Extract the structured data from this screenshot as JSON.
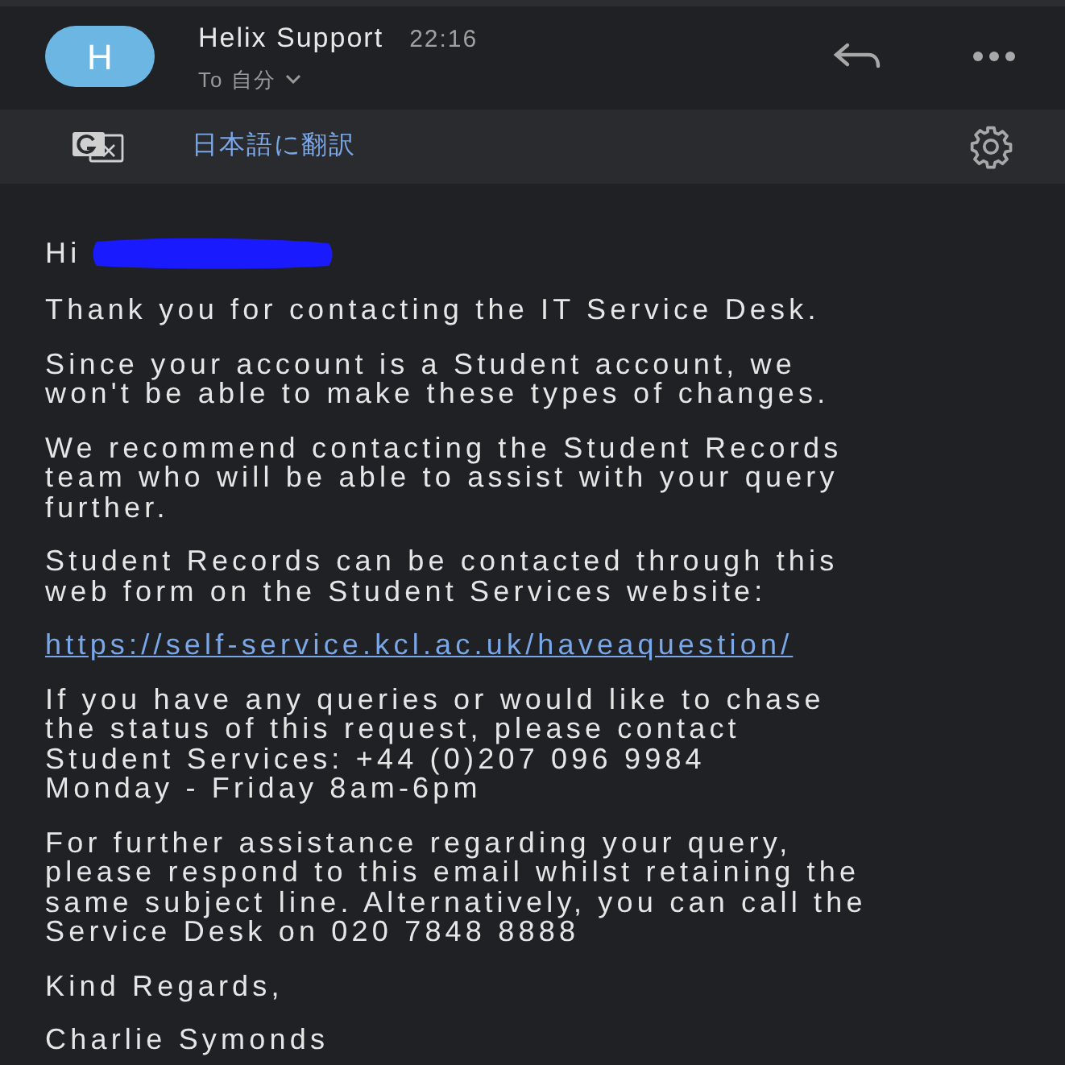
{
  "header": {
    "avatar_letter": "H",
    "sender": "Helix Support",
    "time": "22:16",
    "recipient": "To 自分"
  },
  "translate_bar": {
    "label": "日本語に翻訳"
  },
  "body": {
    "greeting": "Hi",
    "paragraphs": [
      {
        "kind": "text",
        "text": "Thank you for contacting the IT Service Desk."
      },
      {
        "kind": "text",
        "text": "Since your account is a Student account, we\nwon't be able to make these types of changes."
      },
      {
        "kind": "text",
        "text": "We recommend contacting the Student Records\nteam who will be able to assist with your query\nfurther."
      },
      {
        "kind": "text",
        "text": "Student Records can be contacted through this\nweb form on the Student Services website:"
      },
      {
        "kind": "link",
        "text": "https://self-service.kcl.ac.uk/haveaquestion/"
      },
      {
        "kind": "text",
        "text": "If you have any queries or would like to chase\nthe status of this request, please contact\nStudent Services: +44 (0)207 096 9984\nMonday - Friday 8am-6pm"
      },
      {
        "kind": "text",
        "text": "For further assistance regarding your query,\nplease respond to this email whilst retaining the\nsame subject line. Alternatively, you can call the\nService Desk on 020 7848 8888"
      },
      {
        "kind": "text",
        "text": "Kind Regards,"
      },
      {
        "kind": "text",
        "text": "Charlie Symonds"
      }
    ]
  }
}
